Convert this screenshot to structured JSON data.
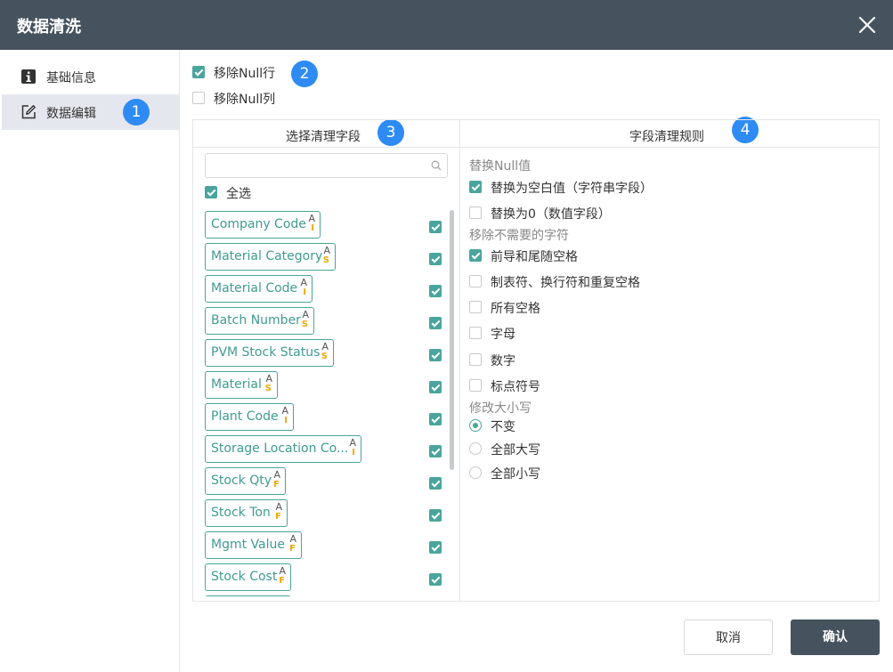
{
  "dialog": {
    "title": "数据清洗"
  },
  "sidebar": {
    "items": [
      {
        "label": "基础信息"
      },
      {
        "label": "数据编辑"
      }
    ]
  },
  "badges": [
    "1",
    "2",
    "3",
    "4"
  ],
  "top_options": [
    {
      "label": "移除Null行",
      "checked": true
    },
    {
      "label": "移除Null列",
      "checked": false
    }
  ],
  "fields_panel": {
    "title": "选择清理字段",
    "search_placeholder": "",
    "select_all_label": "全选",
    "fields": [
      {
        "name": "Company Code",
        "type_a": "A",
        "type_code": "I",
        "checked": true
      },
      {
        "name": "Material Category",
        "type_a": "A",
        "type_code": "S",
        "checked": true
      },
      {
        "name": "Material Code",
        "type_a": "A",
        "type_code": "I",
        "checked": true
      },
      {
        "name": "Batch Number",
        "type_a": "A",
        "type_code": "S",
        "checked": true
      },
      {
        "name": "PVM Stock Status",
        "type_a": "A",
        "type_code": "S",
        "checked": true
      },
      {
        "name": "Material",
        "type_a": "A",
        "type_code": "S",
        "checked": true
      },
      {
        "name": "Plant Code",
        "type_a": "A",
        "type_code": "I",
        "checked": true
      },
      {
        "name": "Storage Location Co...",
        "type_a": "A",
        "type_code": "I",
        "checked": true
      },
      {
        "name": "Stock Qty",
        "type_a": "A",
        "type_code": "F",
        "checked": true
      },
      {
        "name": "Stock Ton",
        "type_a": "A",
        "type_code": "F",
        "checked": true
      },
      {
        "name": "Mgmt Value",
        "type_a": "A",
        "type_code": "F",
        "checked": true
      },
      {
        "name": "Stock Cost",
        "type_a": "A",
        "type_code": "F",
        "checked": true
      }
    ]
  },
  "rules_panel": {
    "title": "字段清理规则",
    "replace_null_heading": "替换Null值",
    "replace_options": [
      {
        "label": "替换为空白值（字符串字段）",
        "checked": true
      },
      {
        "label": "替换为0（数值字段）",
        "checked": false
      }
    ],
    "remove_chars_heading": "移除不需要的字符",
    "remove_options": [
      {
        "label": "前导和尾随空格",
        "checked": true
      },
      {
        "label": "制表符、换行符和重复空格",
        "checked": false
      },
      {
        "label": "所有空格",
        "checked": false
      },
      {
        "label": "字母",
        "checked": false
      },
      {
        "label": "数字",
        "checked": false
      },
      {
        "label": "标点符号",
        "checked": false
      }
    ],
    "case_heading": "修改大小写",
    "case_options": [
      {
        "label": "不变",
        "selected": true
      },
      {
        "label": "全部大写",
        "selected": false
      },
      {
        "label": "全部小写",
        "selected": false
      }
    ]
  },
  "footer": {
    "cancel_label": "取消",
    "ok_label": "确认"
  },
  "colors": {
    "header": "#46535f",
    "accent": "#4aa59c",
    "badge": "#2e8bf4",
    "type_tag": "#f0a80c"
  }
}
